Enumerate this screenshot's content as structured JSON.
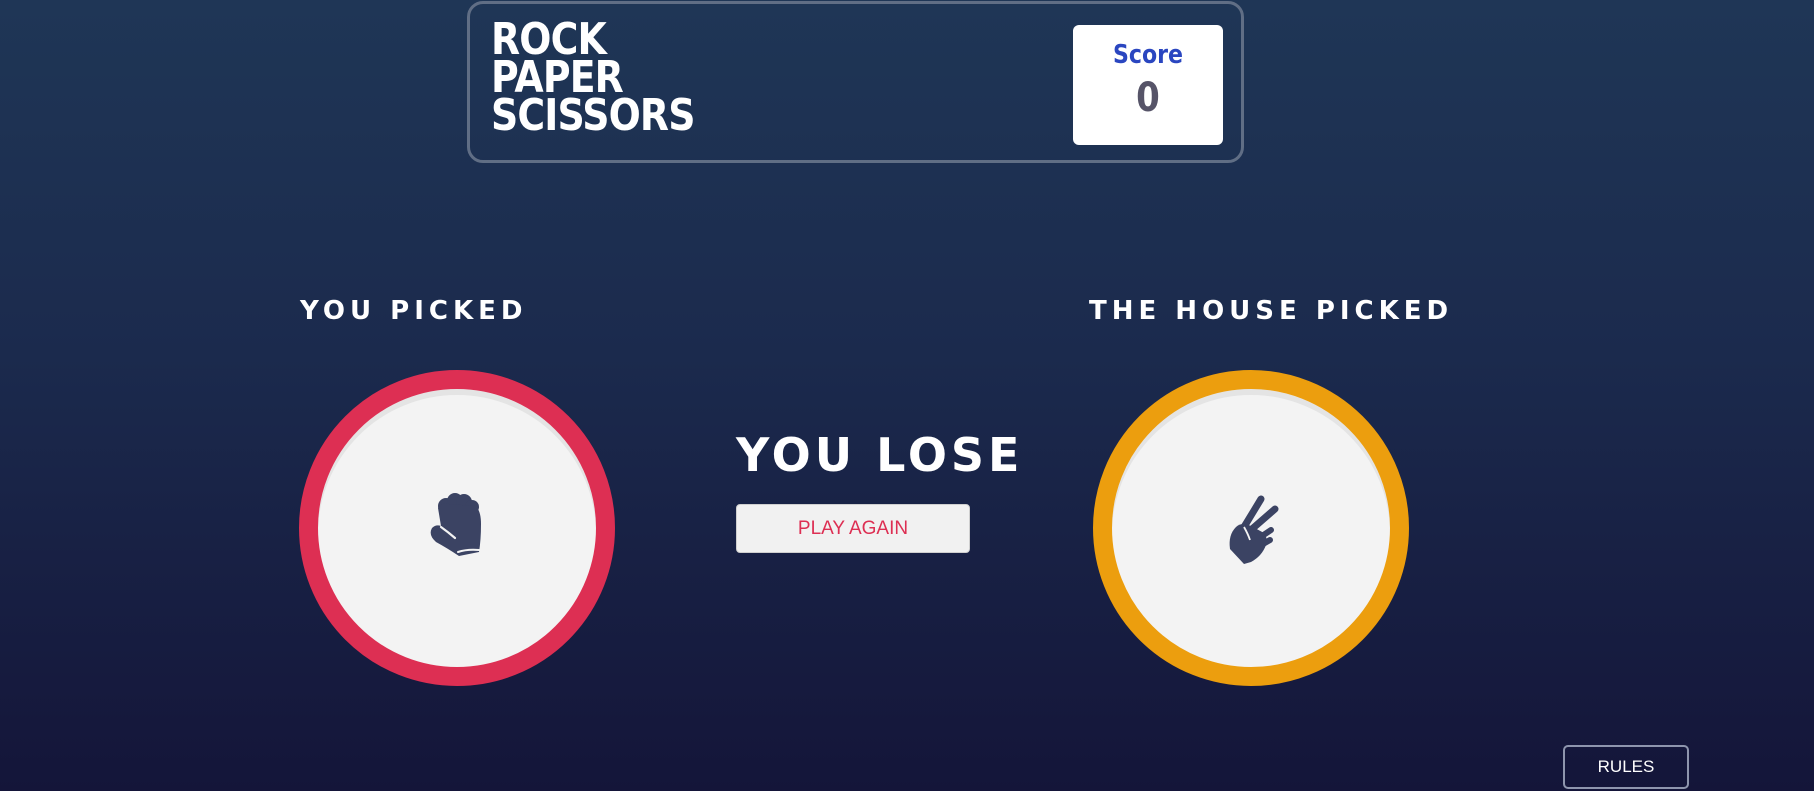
{
  "header": {
    "title_lines": [
      "ROCK",
      "PAPER",
      "SCISSORS"
    ],
    "score_label": "Score",
    "score_value": "0"
  },
  "game": {
    "player_label": "YOU PICKED",
    "house_label": "THE HOUSE PICKED",
    "player_choice": {
      "name": "rock",
      "icon": "rock-icon",
      "ring_color": "#dd2f53"
    },
    "house_choice": {
      "name": "scissors",
      "icon": "scissors-icon",
      "ring_color": "#ec9e0e"
    },
    "result_text": "YOU LOSE",
    "play_again_label": "PLAY AGAIN"
  },
  "footer": {
    "rules_label": "RULES"
  },
  "colors": {
    "icon": "#3b4363",
    "lose_accent": "#dd2f53"
  }
}
